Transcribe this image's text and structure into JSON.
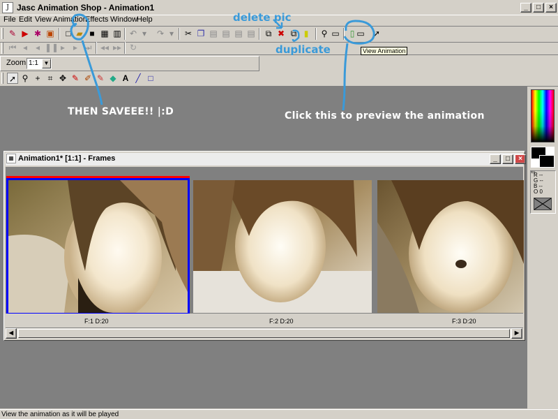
{
  "app": {
    "title": "Jasc Animation Shop - Animation1",
    "icon_label": "Jasc"
  },
  "window_controls": {
    "minimize": "_",
    "maximize": "□",
    "close": "×"
  },
  "menu": [
    "File",
    "Edit",
    "View",
    "Animation",
    "Effects",
    "Window",
    "Help"
  ],
  "zoom": {
    "label": "Zoom:",
    "value": "1:1"
  },
  "tooltip": "View Animation",
  "annotations": {
    "delete_pic": "delete pic",
    "duplicate": "duplicate",
    "then_save": "THEN SAVEEE!! |:D",
    "preview": "Click this to preview the animation"
  },
  "frames_window": {
    "title": "Animation1* [1:1] - Frames",
    "frames": [
      {
        "label": "F:1  D:20",
        "selected": true
      },
      {
        "label": "F:2  D:20",
        "selected": false
      },
      {
        "label": "F:3  D:20",
        "selected": false
      }
    ]
  },
  "color_panel": {
    "r_label": "R --",
    "g_label": "G --",
    "b_label": "B --",
    "o_label": "O 0"
  },
  "status_text": "View the animation as it will be played",
  "colors": {
    "annotation": "#3a9ad9",
    "selection_border": "#0000ff",
    "selection_red": "#ff0000",
    "workspace": "#808080"
  }
}
